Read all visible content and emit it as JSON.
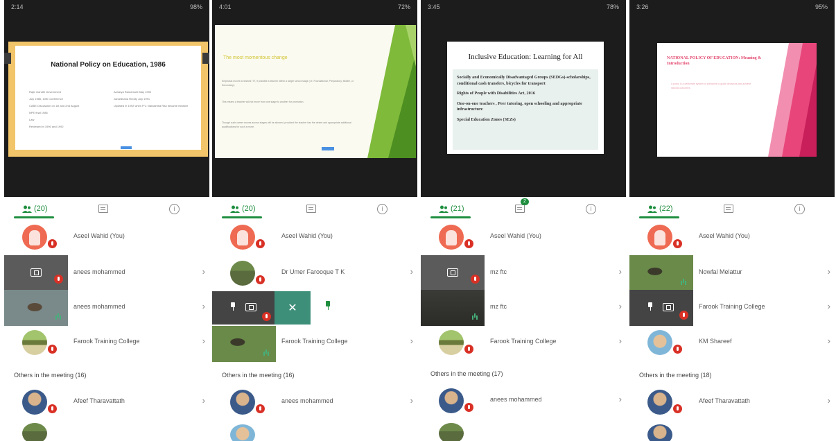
{
  "phones": [
    {
      "status_time": "2:14",
      "status_right": "98%",
      "slide_title": "National Policy on Education, 1986",
      "slide_bullets_left": [
        "Rajiv Gandhi Government",
        "July 1986, 10th Conference",
        "CABE Discussion on 1st and 2nd August",
        "NPE final 1986",
        "Law",
        "Reviewed in 1990 and 1992"
      ],
      "slide_bullets_right": [
        "Acharya Ramamurti May 1990",
        "Janardhana Reddy July 1991",
        "Updated in 1992 when P.V. Narasimha Rao became minister"
      ],
      "people_count": "(20)",
      "participants": [
        {
          "name": "Aseel Wahid (You)"
        },
        {
          "name": "anees mohammed"
        },
        {
          "name": "anees mohammed"
        },
        {
          "name": "Farook Training College"
        }
      ],
      "others_label": "Others in the meeting (16)",
      "others": [
        {
          "name": "Afeef Tharavattath"
        }
      ]
    },
    {
      "status_time": "4:01",
      "status_right": "72%",
      "slide_title": "The most momentous change",
      "slide_text_1": "Emphasis moves to trained ITT, if possible a teacher within a single school stage (i.e. Foundational, Preparatory, Middle, or Secondary).",
      "slide_text_2": "This means a teacher will not move from one stage to another for promotion.",
      "slide_text_3": "Though such career moves across stages will be allowed, provided the teacher has the desire and appropriate additional qualifications for such a move.",
      "people_count": "(20)",
      "participants": [
        {
          "name": "Aseel Wahid (You)"
        },
        {
          "name": "Dr Umer Farooque T K"
        },
        {
          "name": "Farook Training College"
        }
      ],
      "others_label": "Others in the meeting (16)",
      "others": [
        {
          "name": "anees mohammed"
        }
      ]
    },
    {
      "status_time": "3:45",
      "status_right": "78%",
      "slide_title": "Inclusive Education: Learning for All",
      "slide_points": [
        "Socially and Economically Disadvantaged Groups (SEDGs)-scholarships, conditional cash transfers, bicycles for transport",
        "Rights of People with Disabilities Act, 2016",
        "One-on-one teachers , Peer tutoring, open schooling and appropriate infrastructure",
        "Special Education Zones (SEZs)"
      ],
      "people_count": "(21)",
      "chat_badge": "2",
      "participants": [
        {
          "name": "Aseel Wahid (You)"
        },
        {
          "name": "mz ftc"
        },
        {
          "name": "mz ftc"
        },
        {
          "name": "Farook Training College"
        }
      ],
      "others_label": "Others in the meeting (17)",
      "others": [
        {
          "name": "anees mohammed"
        }
      ]
    },
    {
      "status_time": "3:26",
      "status_right": "95%",
      "slide_title": "NATIONAL POLICY OF EDUCATION: Meaning & Introduction",
      "slide_text": "A policy is a deliberate system of principles to guide decisions and achieve rational outcomes",
      "people_count": "(22)",
      "participants": [
        {
          "name": "Aseel Wahid (You)"
        },
        {
          "name": "Nowfal Melattur"
        },
        {
          "name": "Farook Training College"
        },
        {
          "name": "KM Shareef"
        }
      ],
      "others_label": "Others in the meeting (18)",
      "others": [
        {
          "name": "Afeef Tharavattath"
        }
      ]
    }
  ],
  "icons": {
    "people": "people-icon",
    "chat": "chat-icon",
    "info": "info-icon",
    "mic_off": "mic-off-icon",
    "present": "present-screen-icon",
    "pin": "pin-icon",
    "chevron": "chevron-right-icon",
    "close": "close-icon"
  },
  "chevron_glyph": "›",
  "close_glyph": "✕",
  "info_glyph": "i",
  "colors": {
    "accent": "#1e8e3e",
    "mute": "#d93025"
  }
}
